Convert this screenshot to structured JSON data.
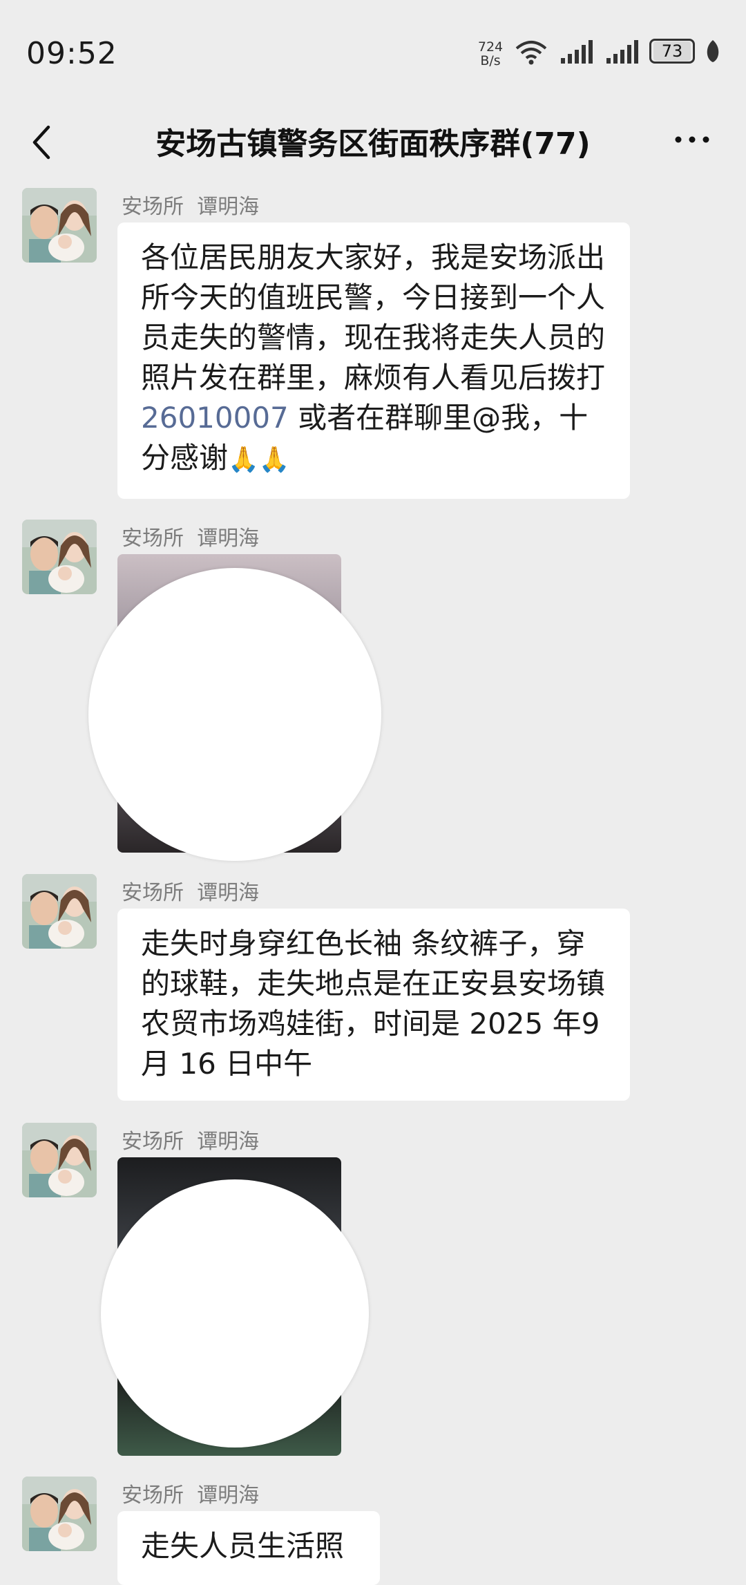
{
  "status_bar": {
    "time": "09:52",
    "net_speed_value": "724",
    "net_speed_unit": "B/s",
    "battery": "73"
  },
  "nav": {
    "title": "安场古镇警务区街面秩序群(77)"
  },
  "messages": [
    {
      "sender_org": "安场所",
      "sender_name": "谭明海",
      "type": "text",
      "text_before": "各位居民朋友大家好，我是安场派出所今天的值班民警，今日接到一个人员走失的警情，现在我将走失人员的照片发在群里，麻烦有人看见后拨打 ",
      "phone": "26010007",
      "text_after": " 或者在群聊里@我，十分感谢",
      "emoji": "🙏🙏"
    },
    {
      "sender_org": "安场所",
      "sender_name": "谭明海",
      "type": "image"
    },
    {
      "sender_org": "安场所",
      "sender_name": "谭明海",
      "type": "text",
      "text": "走失时身穿红色长袖 条纹裤子，穿的球鞋，走失地点是在正安县安场镇农贸市场鸡娃街，时间是 2025 年9 月 16 日中午"
    },
    {
      "sender_org": "安场所",
      "sender_name": "谭明海",
      "type": "image"
    },
    {
      "sender_org": "安场所",
      "sender_name": "谭明海",
      "type": "text",
      "text": "走失人员生活照"
    }
  ],
  "colors": {
    "background": "#ededed",
    "bubble": "#ffffff",
    "link": "#576b95"
  }
}
